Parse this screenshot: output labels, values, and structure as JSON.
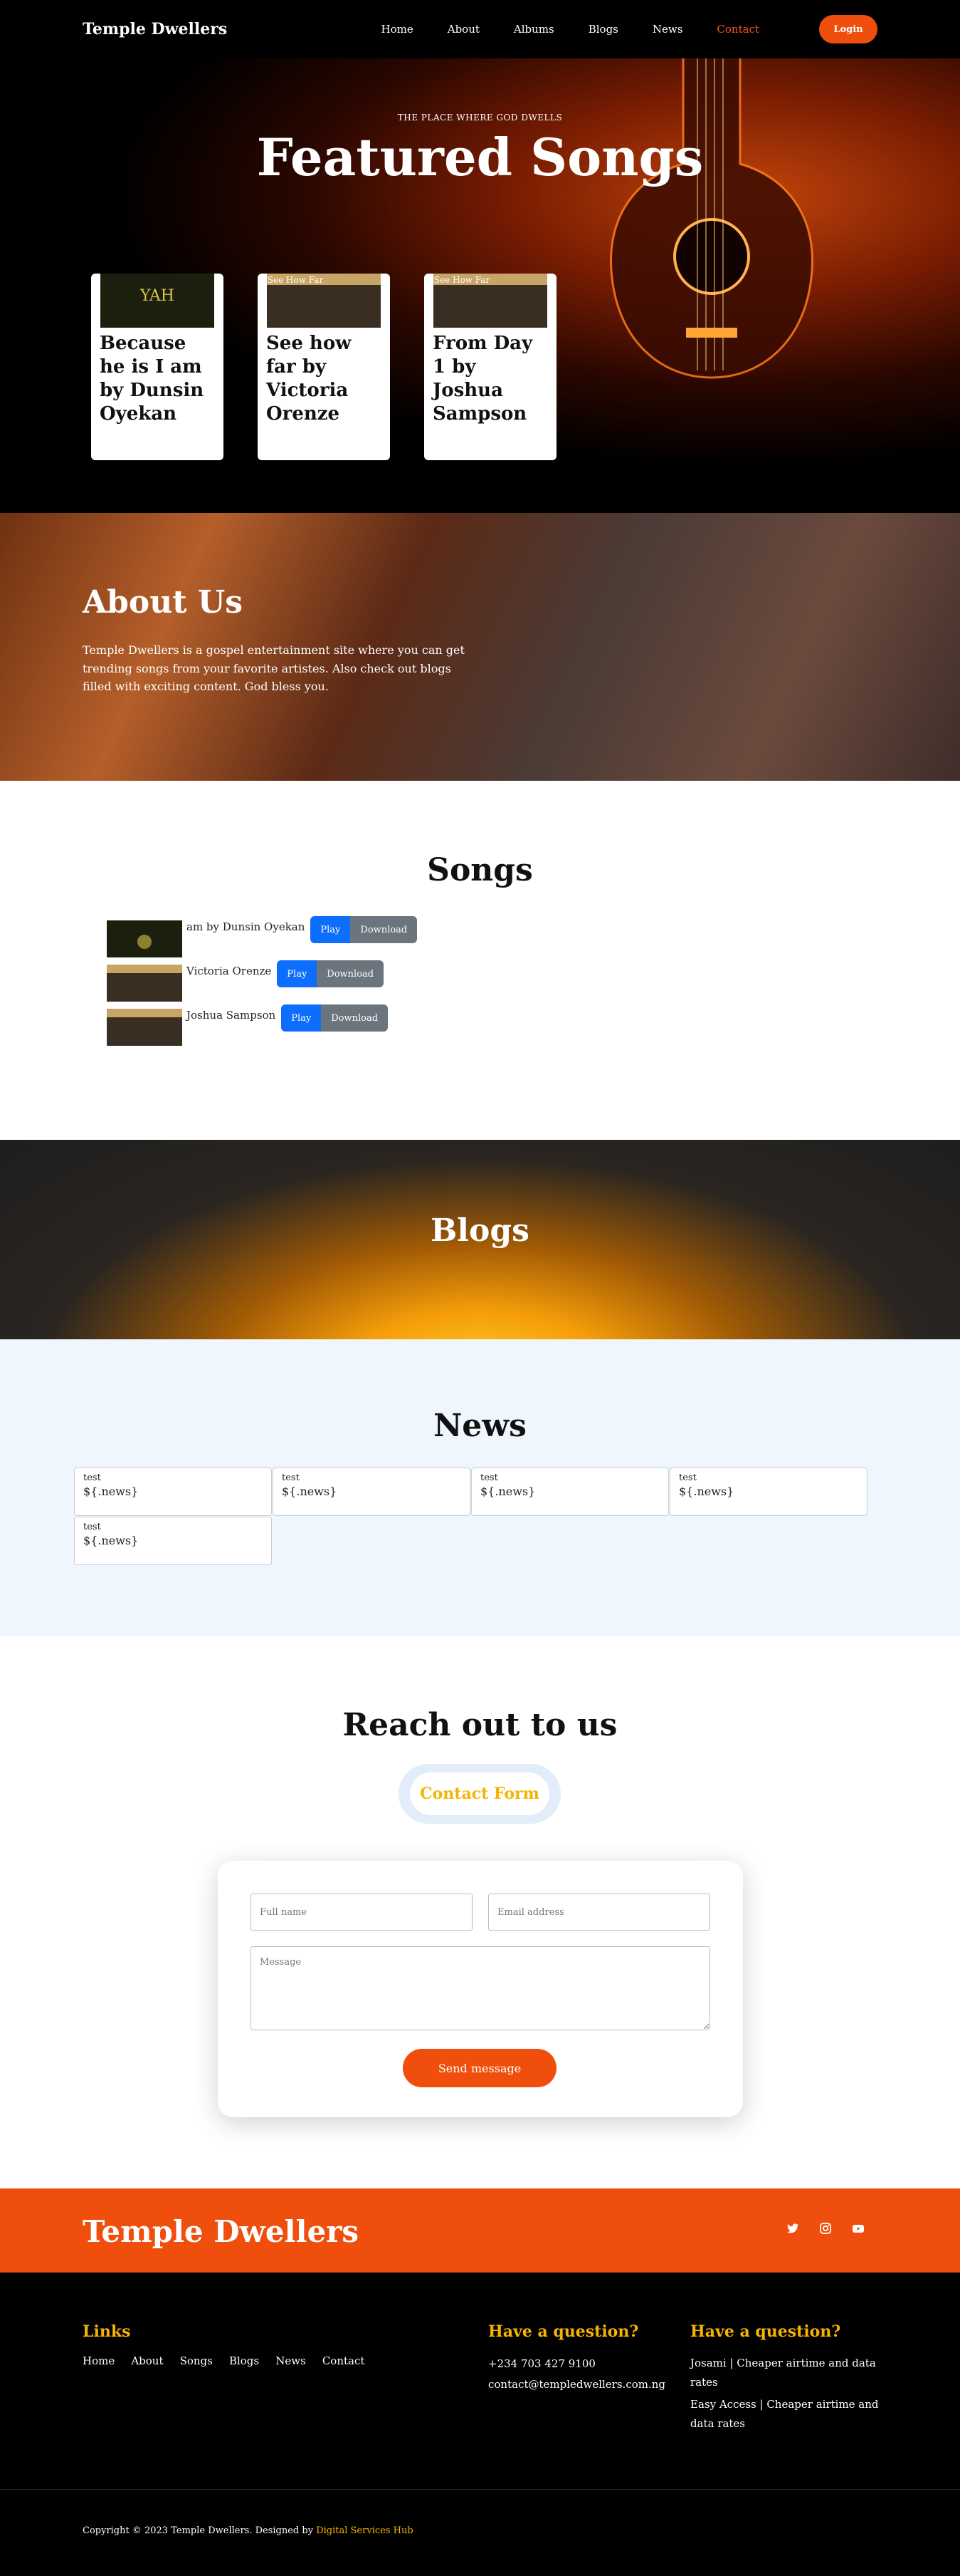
{
  "header": {
    "brand": "Temple Dwellers",
    "nav": [
      "Home",
      "About",
      "Albums",
      "Blogs",
      "News",
      "Contact"
    ],
    "active_nav": "Contact",
    "login": "Login"
  },
  "hero": {
    "subtitle": "THE PLACE WHERE GOD DWELLS",
    "title": "Featured Songs",
    "cards": [
      {
        "title": "Because he is I am by Dunsin Oyekan",
        "thumb_text": "YAH"
      },
      {
        "title": "See how far by Victoria Orenze",
        "thumb_text": "See How Far"
      },
      {
        "title": "From Day 1 by Joshua Sampson",
        "thumb_text": "See How Far"
      }
    ]
  },
  "about": {
    "title": "About Us",
    "text": "Temple Dwellers is a gospel entertainment site where you can get trending songs from your favorite artistes. Also check out blogs filled with exciting content. God bless you."
  },
  "songs": {
    "title": "Songs",
    "items": [
      {
        "title": "am by Dunsin Oyekan",
        "play": "Play",
        "download": "Download"
      },
      {
        "title": "Victoria Orenze",
        "play": "Play",
        "download": "Download"
      },
      {
        "title": "Joshua Sampson",
        "play": "Play",
        "download": "Download"
      }
    ]
  },
  "blogs": {
    "title": "Blogs"
  },
  "news": {
    "title": "News",
    "items": [
      {
        "label": "test",
        "body": "${.news}"
      },
      {
        "label": "test",
        "body": "${.news}"
      },
      {
        "label": "test",
        "body": "${.news}"
      },
      {
        "label": "test",
        "body": "${.news}"
      },
      {
        "label": "test",
        "body": "${.news}"
      }
    ]
  },
  "contact": {
    "title": "Reach out to us",
    "pill": "Contact Form",
    "name_placeholder": "Full name",
    "email_placeholder": "Email address",
    "message_placeholder": "Message",
    "send": "Send message"
  },
  "footer": {
    "brand": "Temple Dwellers",
    "socials": [
      "twitter-icon",
      "instagram-icon",
      "youtube-icon"
    ],
    "links_title": "Links",
    "links": [
      "Home",
      "About",
      "Songs",
      "Blogs",
      "News",
      "Contact"
    ],
    "question_title": "Have a question?",
    "phone": "+234 703 427 9100",
    "email": "contact@templedwellers.com.ng",
    "question_title2": "Have a question?",
    "promo1": "Josami | Cheaper airtime and data rates",
    "promo2": "Easy Access | Cheaper airtime and data rates",
    "copyright": "Copyright © 2023 Temple Dwellers. Designed by ",
    "designer": "Digital Services Hub"
  },
  "colors": {
    "accent": "#f04e0d",
    "gold": "#f6b400",
    "play_blue": "#0d6efd",
    "download_gray": "#6c757d"
  }
}
